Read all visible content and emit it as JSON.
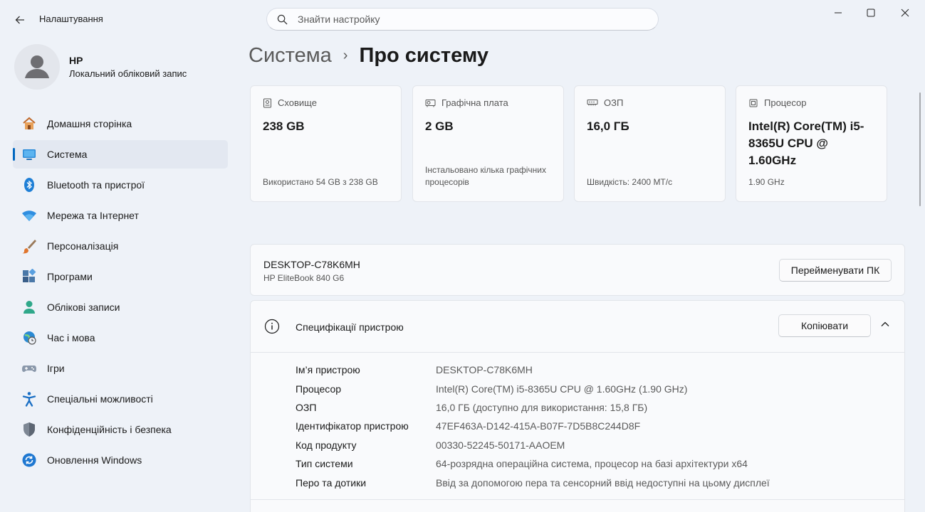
{
  "window": {
    "title": "Налаштування"
  },
  "search": {
    "placeholder": "Знайти настройку"
  },
  "profile": {
    "name": "HP",
    "account_type": "Локальний обліковий запис"
  },
  "sidebar": {
    "items": [
      {
        "label": "Домашня сторінка",
        "icon": "home-icon"
      },
      {
        "label": "Система",
        "icon": "system-icon",
        "active": true
      },
      {
        "label": "Bluetooth та пристрої",
        "icon": "bluetooth-icon"
      },
      {
        "label": "Мережа та Інтернет",
        "icon": "wifi-icon"
      },
      {
        "label": "Персоналізація",
        "icon": "brush-icon"
      },
      {
        "label": "Програми",
        "icon": "apps-icon"
      },
      {
        "label": "Облікові записи",
        "icon": "accounts-icon"
      },
      {
        "label": "Час і мова",
        "icon": "time-language-icon"
      },
      {
        "label": "Ігри",
        "icon": "gamepad-icon"
      },
      {
        "label": "Спеціальні можливості",
        "icon": "accessibility-icon"
      },
      {
        "label": "Конфіденційність і безпека",
        "icon": "shield-icon"
      },
      {
        "label": "Оновлення Windows",
        "icon": "windows-update-icon"
      }
    ]
  },
  "breadcrumb": {
    "parent": "Система",
    "separator": "›",
    "current": "Про систему"
  },
  "cards": [
    {
      "title": "Сховище",
      "value": "238 GB",
      "footer": "Використано 54 GB з 238 GB",
      "icon": "storage-icon"
    },
    {
      "title": "Графічна плата",
      "value": "2 GB",
      "footer": "Інстальовано кілька графічних процесорів",
      "icon": "gpu-icon"
    },
    {
      "title": "ОЗП",
      "value": "16,0 ГБ",
      "footer": "Швидкість: 2400 MT/с",
      "icon": "ram-icon"
    },
    {
      "title": "Процесор",
      "value": "Intel(R) Core(TM) i5-8365U CPU @ 1.60GHz",
      "footer": "1.90 GHz",
      "icon": "cpu-icon"
    }
  ],
  "pc": {
    "name": "DESKTOP-C78K6MH",
    "model": "HP EliteBook 840 G6",
    "rename_label": "Перейменувати ПК"
  },
  "specs": {
    "title": "Специфікації пристрою",
    "copy_label": "Копіювати",
    "rows": [
      {
        "key": "Ім’я пристрою",
        "value": "DESKTOP-C78K6MH"
      },
      {
        "key": "Процесор",
        "value": "Intel(R) Core(TM) i5-8365U CPU @ 1.60GHz (1.90 GHz)"
      },
      {
        "key": "ОЗП",
        "value": "16,0 ГБ (доступно для використання: 15,8 ГБ)"
      },
      {
        "key": "Ідентифікатор пристрою",
        "value": "47EF463A-D142-415A-B07F-7D5B8C244D8F"
      },
      {
        "key": "Код продукту",
        "value": "00330-52245-50171-AAOEM"
      },
      {
        "key": "Тип системи",
        "value": "64-розрядна операційна система, процесор на базі архітектури x64"
      },
      {
        "key": "Перо та дотики",
        "value": "Ввід за допомогою пера та сенсорний ввід недоступні на цьому дисплеї"
      }
    ]
  },
  "colors": {
    "accent": "#0067c0",
    "background": "#eef2f8",
    "card": "#f9fafc"
  }
}
